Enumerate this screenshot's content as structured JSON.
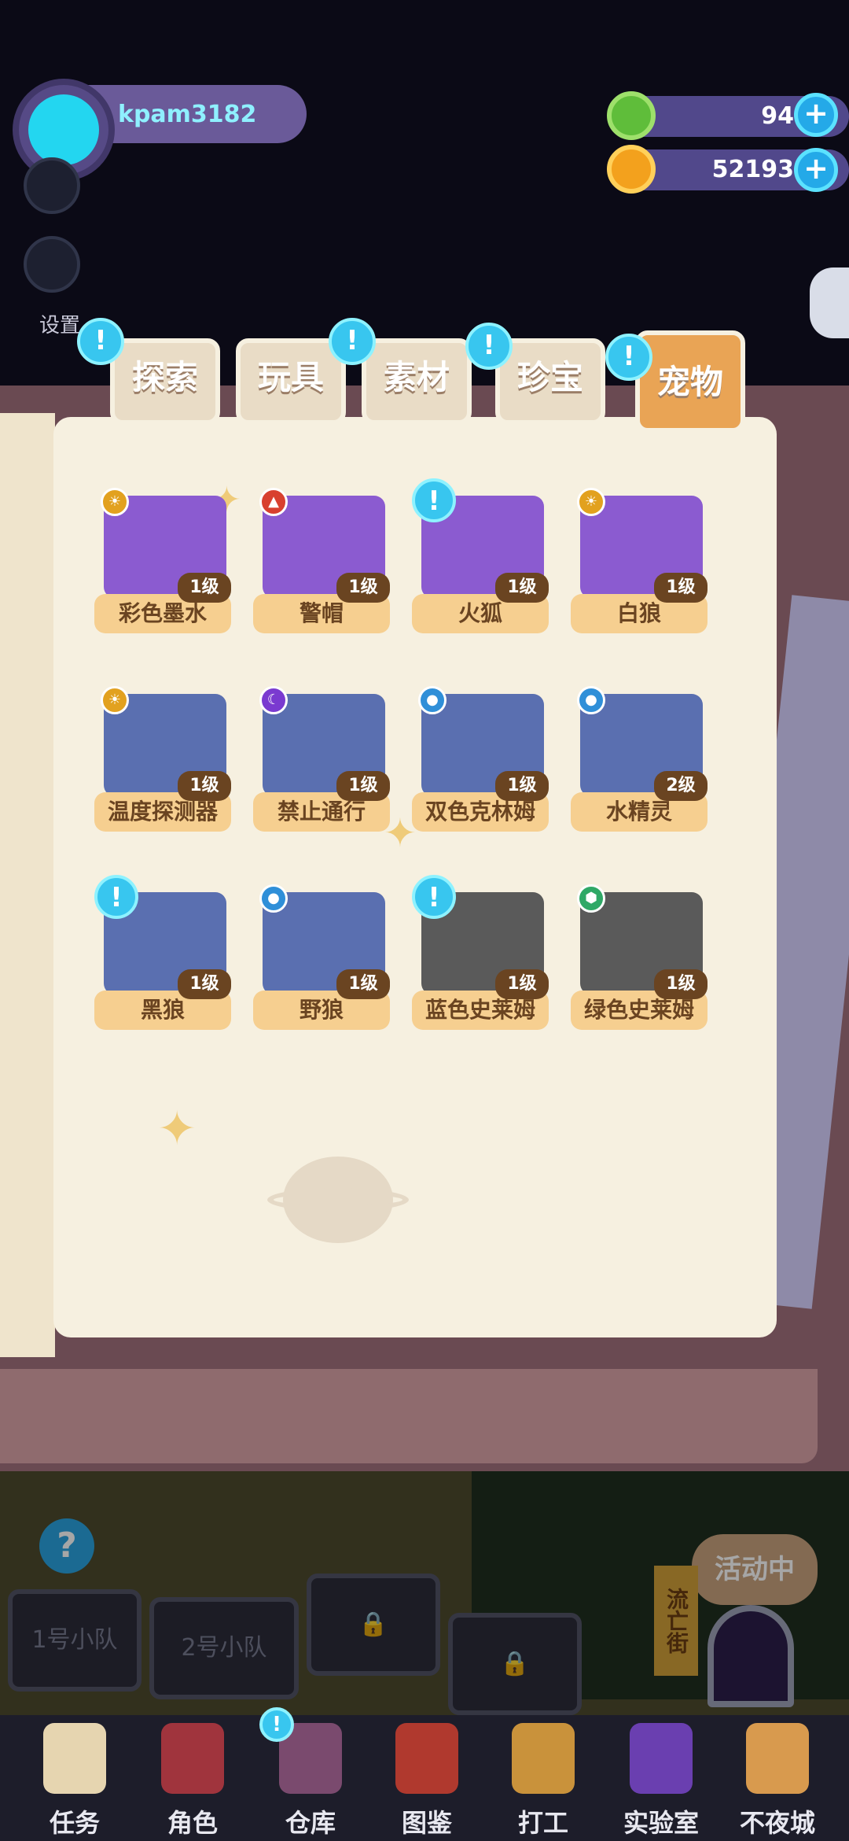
{
  "header": {
    "username": "kpam3182",
    "gems": "94",
    "coins": "52193",
    "settings_label": "设置"
  },
  "tabs": [
    {
      "label": "探索"
    },
    {
      "label": "玩具"
    },
    {
      "label": "素材"
    },
    {
      "label": "珍宝"
    },
    {
      "label": "宠物"
    }
  ],
  "notification_symbol": "!",
  "items": [
    {
      "name": "彩色墨水",
      "level": "1级",
      "color": "#8b5bd0"
    },
    {
      "name": "警帽",
      "level": "1级",
      "color": "#8b5bd0"
    },
    {
      "name": "火狐",
      "level": "1级",
      "color": "#8b5bd0"
    },
    {
      "name": "白狼",
      "level": "1级",
      "color": "#8b5bd0"
    },
    {
      "name": "温度探测器",
      "level": "1级",
      "color": "#5a6fb0"
    },
    {
      "name": "禁止通行",
      "level": "1级",
      "color": "#5a6fb0"
    },
    {
      "name": "双色克林姆",
      "level": "1级",
      "color": "#5a6fb0"
    },
    {
      "name": "水精灵",
      "level": "2级",
      "color": "#5a6fb0"
    },
    {
      "name": "黑狼",
      "level": "1级",
      "color": "#5a6fb0"
    },
    {
      "name": "野狼",
      "level": "1级",
      "color": "#5a6fb0"
    },
    {
      "name": "蓝色史莱姆",
      "level": "1级",
      "color": "#5a5a5a"
    },
    {
      "name": "绿色史莱姆",
      "level": "1级",
      "color": "#5a5a5a"
    }
  ],
  "scene": {
    "squad1": "1号小队",
    "squad2": "2号小队",
    "event_label": "活动中",
    "street_label": "流亡街"
  },
  "nav": [
    {
      "label": "任务"
    },
    {
      "label": "角色"
    },
    {
      "label": "仓库"
    },
    {
      "label": "图鉴"
    },
    {
      "label": "打工"
    },
    {
      "label": "实验室"
    },
    {
      "label": "不夜城"
    }
  ]
}
